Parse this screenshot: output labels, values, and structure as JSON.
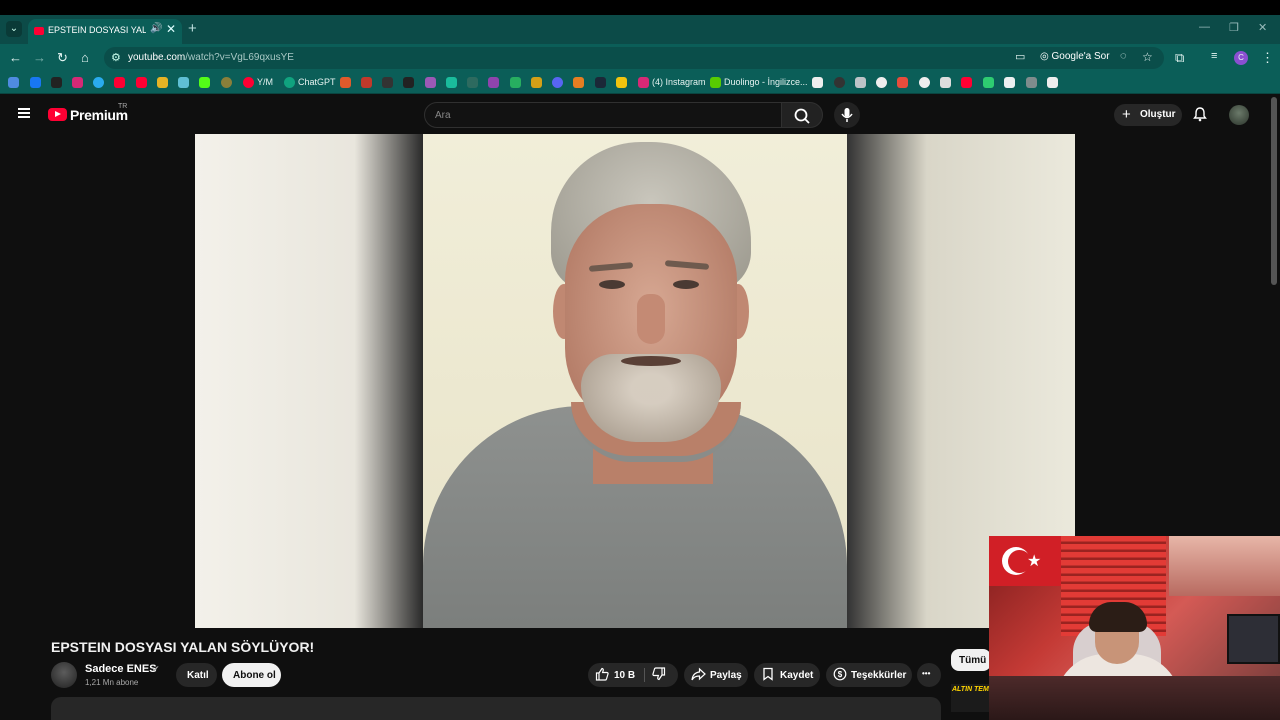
{
  "browser": {
    "tab": {
      "title": "EPSTEIN DOSYASI YALAN SÖYLÜYOR! - YouTube",
      "audio_icon": "speaker-icon",
      "close": "✕"
    },
    "new_tab": "+",
    "url_host": "youtube.com",
    "url_path": "/watch?v=VgL69qxusYE",
    "google_ask": "Google'a Sor",
    "bookmarks": [
      "Y/M",
      "ChatGPT",
      "(4) Instagram",
      "Duolingo - İngilizce..."
    ]
  },
  "youtube": {
    "brand": "Premium",
    "region": "TR",
    "search_placeholder": "Ara",
    "create_label": "Oluştur",
    "video": {
      "title": "EPSTEIN DOSYASI YALAN SÖYLÜYOR!",
      "channel_name": "Sadece ENES",
      "subscribers": "1,21 Mn abone",
      "join_label": "Katıl",
      "subscribe_label": "Abone ol",
      "likes": "10 B",
      "share_label": "Paylaş",
      "save_label": "Kaydet",
      "thanks_label": "Teşekkürler",
      "more": "•••"
    },
    "side_chip": "Tümü",
    "side_thumb_text": "ALTIN TEMA"
  },
  "colors": {
    "accent_red": "#ff0033",
    "browser_teal": "#0b5e58",
    "bg": "#0f0f0f"
  }
}
